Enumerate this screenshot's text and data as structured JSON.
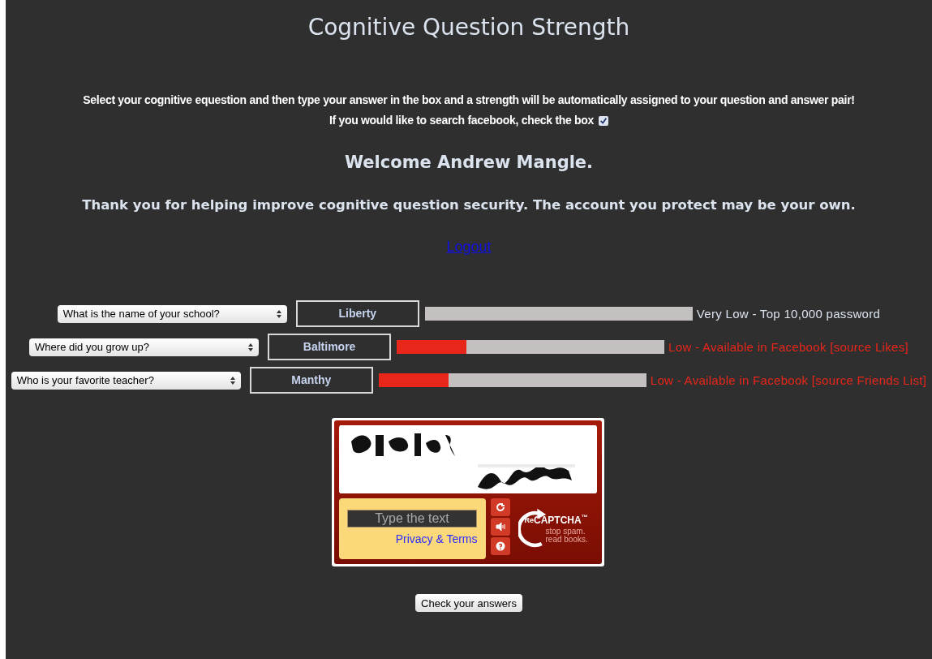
{
  "title": "Cognitive Question Strength",
  "intro": "Select your cognitive equestion and then type your answer in the box and a strength will be automatically assigned to your question and answer pair!",
  "facebook": {
    "label": "If you would like to search facebook, check the box",
    "checked": true
  },
  "welcome": "Welcome Andrew Mangle.",
  "thanks": "Thank you for helping improve cognitive question security. The account you protect may be your own.",
  "logout": "Logout",
  "questions": [
    {
      "question": "What is the name of your school?",
      "answer": "Liberty",
      "strength": "Very Low - Top 10,000 password",
      "color": "#dbe3ee"
    },
    {
      "question": "Where did you grow up?",
      "answer": "Baltimore",
      "level": 0.26,
      "strength": "Low - Available in Facebook [source Likes]",
      "color": "#e8261a"
    },
    {
      "question": "Who is your favorite teacher?",
      "answer": "Manthy",
      "level": 0.26,
      "strength": "Low - Available in Facebook [source Friends List]",
      "color": "#e8261a"
    }
  ],
  "captcha": {
    "placeholder": "Type the text",
    "privacy_link": "Privacy & Terms",
    "brand_prefix": "Re",
    "brand": "CAPTCHA",
    "trademark": "™",
    "tagline_1": "stop spam.",
    "tagline_2": "read books."
  },
  "submit": "Check your answers"
}
